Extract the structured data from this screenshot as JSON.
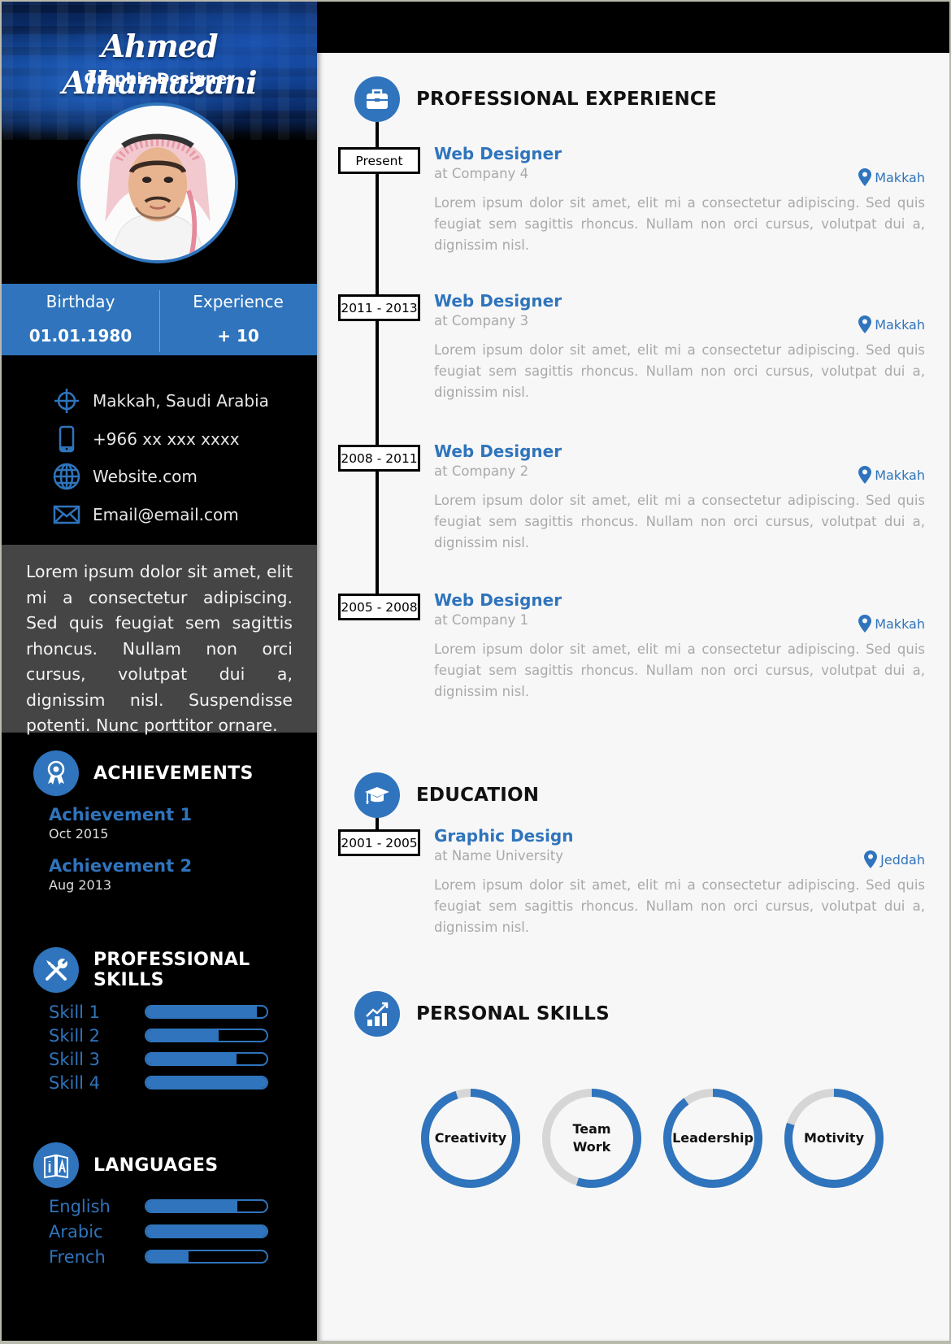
{
  "colors": {
    "accent": "#2f74bc",
    "track": "#d6d6d6",
    "sidebar_bg": "#000000",
    "summary_bg": "#454545"
  },
  "header": {
    "name": "Ahmed Alhamazani",
    "job_title": "Graphic Designer",
    "avatar_icon": "portrait-illustration"
  },
  "stats": [
    {
      "label": "Birthday",
      "value": "01.01.1980"
    },
    {
      "label": "Experience",
      "value": "+ 10"
    }
  ],
  "contacts": [
    {
      "icon": "location-crosshair-icon",
      "text": "Makkah, Saudi Arabia"
    },
    {
      "icon": "phone-icon",
      "text": "+966 xx xxx xxxx"
    },
    {
      "icon": "globe-icon",
      "text": "Website.com"
    },
    {
      "icon": "mail-icon",
      "text": "Email@email.com"
    }
  ],
  "summary": "Lorem ipsum dolor sit amet, elit mi a consectetur adipiscing. Sed quis feugiat sem sagittis rhoncus. Nullam non orci cursus, volutpat dui a, dignissim nisl. Suspendisse potenti. Nunc porttitor ornare.",
  "achievements": {
    "title": "ACHIEVEMENTS",
    "icon": "award-ribbon-icon",
    "items": [
      {
        "title": "Achievement 1",
        "date": "Oct 2015"
      },
      {
        "title": "Achievement 2",
        "date": "Aug 2013"
      }
    ]
  },
  "professional_skills": {
    "title": "PROFESSIONAL SKILLS",
    "icon": "tools-icon",
    "items": [
      {
        "label": "Skill 1",
        "level_percent": 92
      },
      {
        "label": "Skill 2",
        "level_percent": 60
      },
      {
        "label": "Skill 3",
        "level_percent": 75
      },
      {
        "label": "Skill 4",
        "level_percent": 100
      }
    ]
  },
  "languages": {
    "title": "LANGUAGES",
    "icon": "translate-book-icon",
    "items": [
      {
        "label": "English",
        "level_percent": 76
      },
      {
        "label": "Arabic",
        "level_percent": 100
      },
      {
        "label": "French",
        "level_percent": 35
      }
    ]
  },
  "experience": {
    "title": "PROFESSIONAL EXPERIENCE",
    "icon": "briefcase-icon",
    "items": [
      {
        "period": "Present",
        "role": "Web Designer",
        "org": "at Company 4",
        "location": "Makkah",
        "description": "Lorem ipsum dolor sit amet, elit mi a consectetur adipiscing. Sed quis feugiat sem sagittis rhoncus. Nullam non orci cursus, volutpat dui a, dignissim nisl."
      },
      {
        "period": "2011 - 2013",
        "role": "Web Designer",
        "org": "at Company 3",
        "location": "Makkah",
        "description": "Lorem ipsum dolor sit amet, elit mi a consectetur adipiscing. Sed quis feugiat sem sagittis rhoncus. Nullam non orci cursus, volutpat dui a, dignissim nisl."
      },
      {
        "period": "2008 - 2011",
        "role": "Web Designer",
        "org": "at Company 2",
        "location": "Makkah",
        "description": "Lorem ipsum dolor sit amet, elit mi a consectetur adipiscing. Sed quis feugiat sem sagittis rhoncus. Nullam non orci cursus, volutpat dui a, dignissim nisl."
      },
      {
        "period": "2005 - 2008",
        "role": "Web Designer",
        "org": "at Company 1",
        "location": "Makkah",
        "description": "Lorem ipsum dolor sit amet, elit mi a consectetur adipiscing. Sed quis feugiat sem sagittis rhoncus. Nullam non orci cursus, volutpat dui a, dignissim nisl."
      }
    ]
  },
  "education": {
    "title": "EDUCATION",
    "icon": "graduation-cap-icon",
    "items": [
      {
        "period": "2001 - 2005",
        "role": "Graphic Design",
        "org": "at Name University",
        "location": "Jeddah",
        "description": "Lorem ipsum dolor sit amet, elit mi a consectetur adipiscing. Sed quis feugiat sem sagittis rhoncus. Nullam non orci cursus, volutpat dui a, dignissim nisl."
      }
    ]
  },
  "personal_skills": {
    "title": "PERSONAL SKILLS",
    "icon": "growth-chart-icon",
    "items": [
      {
        "label": "Creativity",
        "level_percent": 95
      },
      {
        "label": "Team Work",
        "level_percent": 55
      },
      {
        "label": "Leadership",
        "level_percent": 90
      },
      {
        "label": "Motivity",
        "level_percent": 80
      }
    ]
  }
}
